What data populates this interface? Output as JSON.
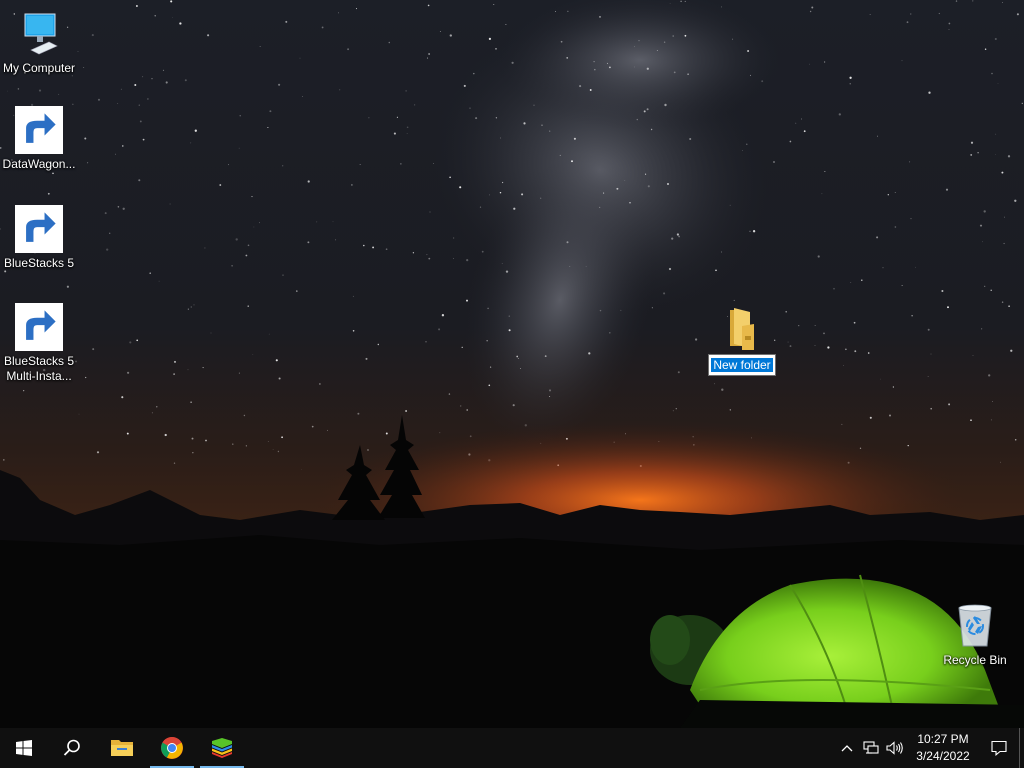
{
  "desktop": {
    "icons": [
      {
        "label": "My Computer",
        "icon": "computer-icon"
      },
      {
        "label": "DataWagon...",
        "icon": "datawagon-icon"
      },
      {
        "label": "BlueStacks 5",
        "icon": "bluestacks-icon"
      },
      {
        "label": "BlueStacks 5\nMulti-Insta...",
        "icon": "bluestacks-multi-icon"
      },
      {
        "label": "Recycle Bin",
        "icon": "recycle-bin-icon"
      }
    ],
    "new_folder": {
      "name": "New folder",
      "icon": "folder-icon",
      "state": "renaming"
    }
  },
  "taskbar": {
    "apps": [
      {
        "name": "start",
        "icon": "windows-logo-icon"
      },
      {
        "name": "search",
        "icon": "search-icon"
      },
      {
        "name": "file-explorer",
        "icon": "folder-icon"
      },
      {
        "name": "chrome",
        "icon": "chrome-icon",
        "running": true
      },
      {
        "name": "bluestacks",
        "icon": "bluestacks-icon",
        "running": true
      }
    ],
    "tray": {
      "time": "10:27 PM",
      "date": "3/24/2022",
      "icons": [
        "chevron-up-icon",
        "network-icon",
        "volume-icon",
        "notification-icon"
      ]
    }
  },
  "colors": {
    "taskbar_bg": "#101010",
    "selection": "#0078d7",
    "tent_green": "#7cd61a"
  }
}
